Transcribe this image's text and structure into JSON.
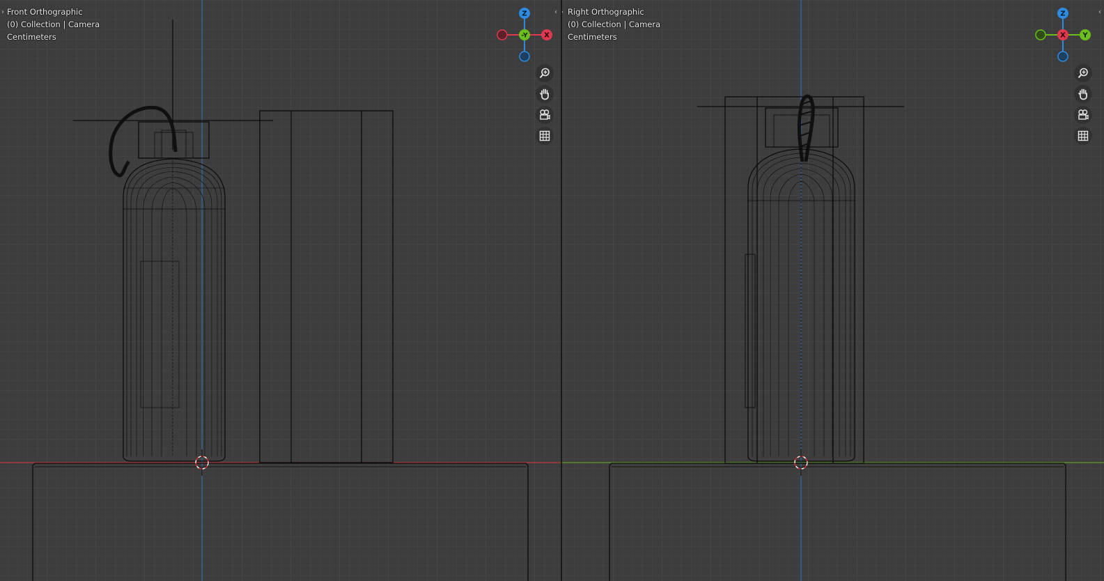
{
  "left_view": {
    "view_name": "Front Orthographic",
    "collection_line": "(0) Collection | Camera",
    "units": "Centimeters",
    "gizmo": {
      "top": "Z",
      "center": "-Y",
      "right": "X"
    }
  },
  "right_view": {
    "view_name": "Right Orthographic",
    "collection_line": "(0) Collection | Camera",
    "units": "Centimeters",
    "gizmo": {
      "top": "Z",
      "center": "X",
      "right": "Y"
    }
  },
  "nav_tools": [
    "zoom-icon",
    "pan-hand-icon",
    "camera-view-icon",
    "ortho-grid-icon"
  ],
  "colors": {
    "background": "#3d3d3d",
    "grid_minor": "#464646",
    "grid_major": "#4f4f4f",
    "axis_x": "#c0393b",
    "axis_y": "#5d9b26",
    "axis_z": "#2f6fb2",
    "gizmo_x": "#e0384f",
    "gizmo_y": "#6cbe1a",
    "gizmo_z": "#2d8be0",
    "wire": "#0c0c0c"
  }
}
